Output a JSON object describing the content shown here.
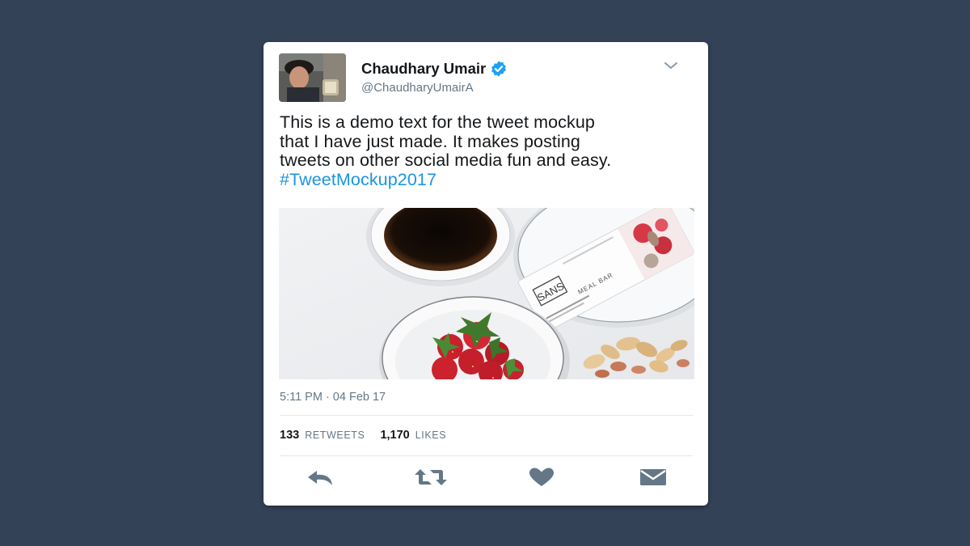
{
  "tweet": {
    "display_name": "Chaudhary Umair",
    "handle": "@ChaudharyUmairA",
    "text_lines": [
      "This is a demo text for the tweet mockup",
      "that I have just made. It makes posting",
      "tweets on other social media fun and easy."
    ],
    "hashtag": "#TweetMockup2017",
    "timestamp": "5:11 PM · 04 Feb 17",
    "retweets_count": "133",
    "retweets_label": "RETWEETS",
    "likes_count": "1,170",
    "likes_label": "LIKES",
    "verified": true
  },
  "media": {
    "bar_brand": "SANS",
    "bar_label": "MEAL BAR"
  },
  "icons": {
    "menu": "chevron-down-icon",
    "verified": "verified-badge-icon",
    "reply": "reply-icon",
    "retweet": "retweet-icon",
    "like": "heart-icon",
    "message": "envelope-icon"
  },
  "colors": {
    "background": "#344257",
    "card": "#ffffff",
    "hashtag": "#1b95e0",
    "verified": "#1da1f2",
    "action_icons": "#657786"
  }
}
